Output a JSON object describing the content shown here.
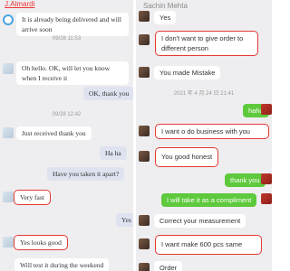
{
  "left": {
    "contact_name": "J.Almardi",
    "messages": [
      {
        "text": "It is already being delivered and will arrive soon",
        "side": "in"
      },
      {
        "text": "09/28 11:53",
        "side": "time"
      },
      {
        "text": "Oh hello. OK, will let you know when I receive it",
        "side": "in"
      },
      {
        "text": "OK, thank you",
        "side": "out"
      },
      {
        "text": "09/28 12:42",
        "side": "time"
      },
      {
        "text": "Just received thank you",
        "side": "in"
      },
      {
        "text": "Ha ha",
        "side": "out"
      },
      {
        "text": "Have you taken it apart?",
        "side": "out"
      },
      {
        "text": "Very fast",
        "side": "in"
      },
      {
        "text": "Yes",
        "side": "out"
      },
      {
        "text": "Yes looks good",
        "side": "in"
      },
      {
        "text": "Will test it during the weekend",
        "side": "in"
      }
    ]
  },
  "right": {
    "contact_name": "Sachin Mehta",
    "messages": [
      {
        "text": "Yes",
        "side": "in"
      },
      {
        "text": "I don't want to give order to different person",
        "side": "in"
      },
      {
        "text": "You made Mistake",
        "side": "in"
      },
      {
        "text": "2021 年 4 月 24 日 21:41",
        "side": "time"
      },
      {
        "text": "haha",
        "side": "out"
      },
      {
        "text": "I want o do business with you",
        "side": "in"
      },
      {
        "text": "You good honest",
        "side": "in"
      },
      {
        "text": "thank you",
        "side": "out"
      },
      {
        "text": "I will take it as a compliment",
        "side": "out"
      },
      {
        "text": "Correct your measurement",
        "side": "in"
      },
      {
        "text": "I want make 600 pcs same",
        "side": "in"
      },
      {
        "text": "Order",
        "side": "in"
      }
    ]
  },
  "colors": {
    "highlight": "#e53935",
    "outgoing_right": "#5ec93c",
    "outgoing_left": "#dfe3f0",
    "name_left": "#e33333"
  }
}
